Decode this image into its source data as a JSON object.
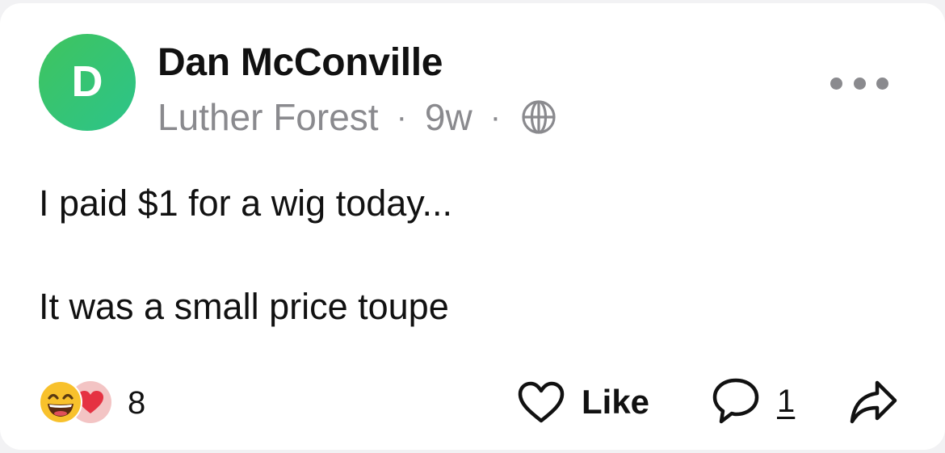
{
  "post": {
    "avatar_letter": "D",
    "author": "Dan McConville",
    "location": "Luther Forest",
    "separator": "·",
    "age": "9w",
    "visibility_icon": "globe-icon",
    "more_icon": "more-options-icon",
    "text_line_1": "I paid $1 for a wig today...",
    "text_line_2": "It was a small price toupe"
  },
  "reactions": {
    "icons": [
      "laughing-emoji-icon",
      "heart-emoji-icon"
    ],
    "count": "8"
  },
  "actions": {
    "like_label": "Like",
    "comment_count": "1",
    "share_icon": "share-icon"
  },
  "colors": {
    "avatar": "#34c46f",
    "meta_text": "#8a8a8e",
    "heart": "#e53242",
    "emoji_face": "#f8c12c"
  }
}
